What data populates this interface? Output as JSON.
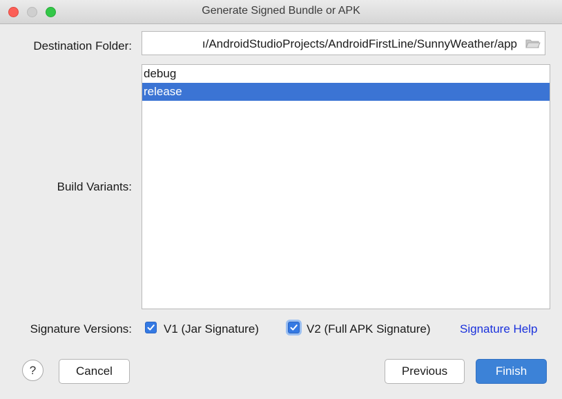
{
  "window": {
    "title": "Generate Signed Bundle or APK"
  },
  "destination": {
    "label": "Destination Folder:",
    "value": "ı/AndroidStudioProjects/AndroidFirstLine/SunnyWeather/app",
    "icon": "folder-icon"
  },
  "build_variants": {
    "label": "Build Variants:",
    "items": [
      {
        "label": "debug",
        "selected": false
      },
      {
        "label": "release",
        "selected": true
      }
    ]
  },
  "signature": {
    "label": "Signature Versions:",
    "v1": {
      "label": "V1 (Jar Signature)",
      "checked": true
    },
    "v2": {
      "label": "V2 (Full APK Signature)",
      "checked": true
    },
    "help_link": "Signature Help"
  },
  "buttons": {
    "help": "?",
    "cancel": "Cancel",
    "previous": "Previous",
    "finish": "Finish"
  },
  "colors": {
    "accent": "#3c82d7",
    "selection": "#3b74d4",
    "link": "#1a31dc"
  }
}
